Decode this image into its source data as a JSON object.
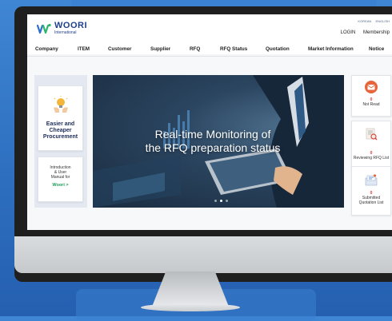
{
  "site": {
    "logo_name": "WOORI",
    "logo_sub": "International",
    "lang_korean": "KOREAN",
    "lang_english": "ENGLISH",
    "login": "LOGIN",
    "membership": "Membership"
  },
  "nav": {
    "items": [
      {
        "label": "Company"
      },
      {
        "label": "ITEM"
      },
      {
        "label": "Customer"
      },
      {
        "label": "Supplier"
      },
      {
        "label": "RFQ"
      },
      {
        "label": "RFQ Status"
      },
      {
        "label": "Quotation"
      },
      {
        "label": "Market Information"
      },
      {
        "label": "Notice"
      }
    ]
  },
  "left_cards": {
    "procurement_lines": [
      "Easier and",
      "Cheaper",
      "Procurement"
    ],
    "manual_lines": [
      "Introduction",
      "& User",
      "Manual for"
    ],
    "manual_link": "Woori >"
  },
  "banner": {
    "line1": "Real-time Monitoring of",
    "line2": "the RFQ preparation status"
  },
  "right_cards": [
    {
      "count": "0",
      "label_lines": [
        "Not Read"
      ],
      "icon": "envelope-icon",
      "color": "#e8643a"
    },
    {
      "count": "0",
      "label_lines": [
        "Reviewing RFQ List"
      ],
      "icon": "document-review-icon",
      "color": "#d8463a"
    },
    {
      "count": "0",
      "label_lines": [
        "Submitted",
        "Quotation List"
      ],
      "icon": "submitted-list-icon",
      "color": "#3a78d8"
    }
  ],
  "colors": {
    "brand_blue": "#1e3f8a",
    "logo_green": "#2bb56e",
    "logo_blue": "#2f6fd0",
    "link_green": "#1e9b5a",
    "count_red": "#dd3333",
    "background_blue": "#3f86d4"
  }
}
